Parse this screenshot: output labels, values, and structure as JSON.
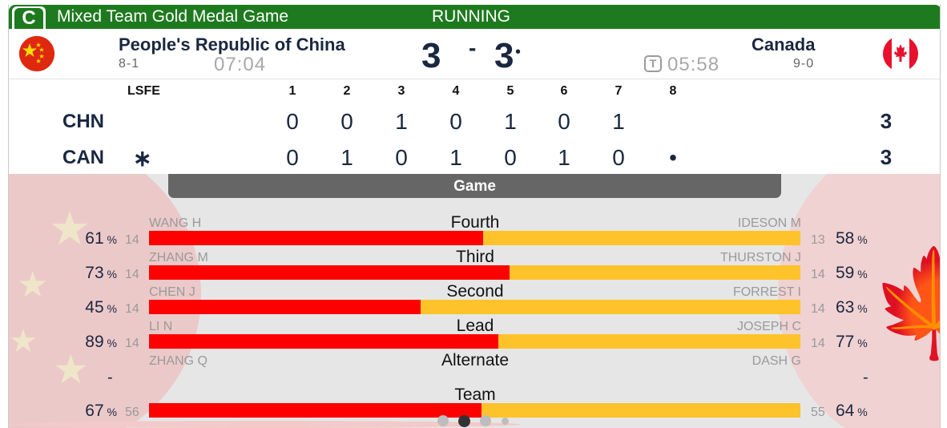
{
  "header": {
    "badge": "C",
    "title": "Mixed Team Gold Medal Game",
    "status": "RUNNING"
  },
  "teams": {
    "left": {
      "name": "People's Republic of China",
      "record": "8-1",
      "clock": "07:04",
      "score": "3",
      "code": "CHN",
      "flag": "china-flag-icon"
    },
    "right": {
      "name": "Canada",
      "record": "9-0",
      "clock": "05:58",
      "score": "3",
      "code": "CAN",
      "flag": "canada-flag-icon",
      "timeout_icon": "T"
    },
    "score_separator": "-",
    "hammer_marker": "•"
  },
  "ends": {
    "lsfe_label": "LSFE",
    "lsfe_marker": "∗",
    "headers": [
      "1",
      "2",
      "3",
      "4",
      "5",
      "6",
      "7",
      "8"
    ],
    "chn": [
      "0",
      "0",
      "1",
      "0",
      "1",
      "0",
      "1",
      ""
    ],
    "can": [
      "0",
      "1",
      "0",
      "1",
      "0",
      "1",
      "0",
      "•"
    ],
    "chn_total": "3",
    "can_total": "3"
  },
  "stats": {
    "tab_label": "Game",
    "rows": [
      {
        "position": "Fourth",
        "left_player": "WANG H",
        "right_player": "IDESON M",
        "left_pct": "61",
        "right_pct": "58",
        "left_shots": "14",
        "right_shots": "13",
        "share": 0.513
      },
      {
        "position": "Third",
        "left_player": "ZHANG M",
        "right_player": "THURSTON J",
        "left_pct": "73",
        "right_pct": "59",
        "left_shots": "14",
        "right_shots": "14",
        "share": 0.553
      },
      {
        "position": "Second",
        "left_player": "CHEN J",
        "right_player": "FORREST I",
        "left_pct": "45",
        "right_pct": "63",
        "left_shots": "14",
        "right_shots": "14",
        "share": 0.417
      },
      {
        "position": "Lead",
        "left_player": "LI N",
        "right_player": "JOSEPH C",
        "left_pct": "89",
        "right_pct": "77",
        "left_shots": "14",
        "right_shots": "14",
        "share": 0.536
      },
      {
        "position": "Alternate",
        "left_player": "ZHANG Q",
        "right_player": "DASH G",
        "left_pct": "-",
        "right_pct": "-"
      },
      {
        "position": "Team",
        "left_player": "",
        "right_player": "",
        "left_pct": "67",
        "right_pct": "64",
        "left_shots": "56",
        "right_shots": "55",
        "share": 0.511
      }
    ],
    "pct_unit": "%"
  },
  "colors": {
    "header_green": "#1e7a1e",
    "chn_bar": "#ff0000",
    "can_bar": "#fec32b",
    "text_navy": "#1a2740"
  },
  "pager": {
    "pages": 4,
    "active": 1
  }
}
